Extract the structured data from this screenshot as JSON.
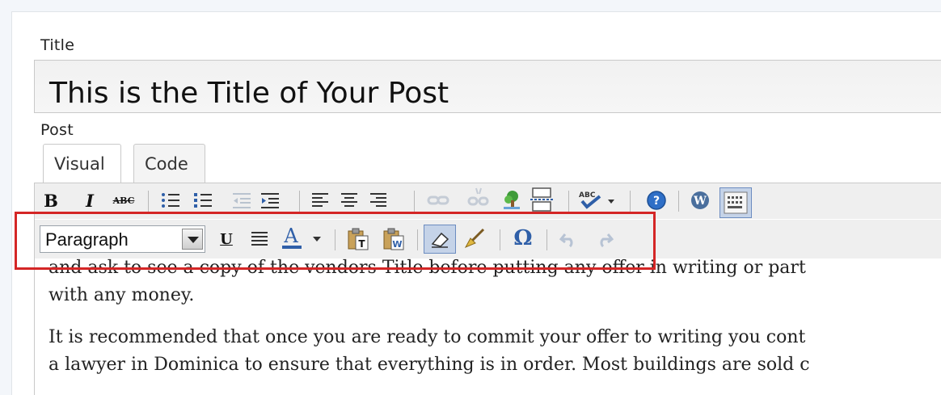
{
  "title_field": {
    "label": "Title",
    "value": "This is the Title of Your Post"
  },
  "post": {
    "label": "Post",
    "tabs": [
      {
        "label": "Visual",
        "active": true
      },
      {
        "label": "Code",
        "active": false
      }
    ]
  },
  "toolbar_row1": [
    {
      "name": "bold",
      "glyph": "B"
    },
    {
      "name": "italic",
      "glyph": "I"
    },
    {
      "name": "strikethrough",
      "glyph": "ABC"
    }
  ],
  "toolbar_row2": {
    "format_select": "Paragraph",
    "underline_glyph": "U",
    "omega_glyph": "Ω",
    "font_color_glyph": "A"
  },
  "content": {
    "paragraphs": [
      "and ask to see a copy of the vendors Title before putting any offer in writing or part\nwith any money.",
      "It is recommended that once you are ready to commit your offer to writing you cont\na lawyer in Dominica to ensure that everything is in order. Most buildings are sold c"
    ]
  },
  "colors": {
    "highlight": "#d42626",
    "toolbar_bg": "#efefef",
    "active_button": "#c5d3e8"
  }
}
